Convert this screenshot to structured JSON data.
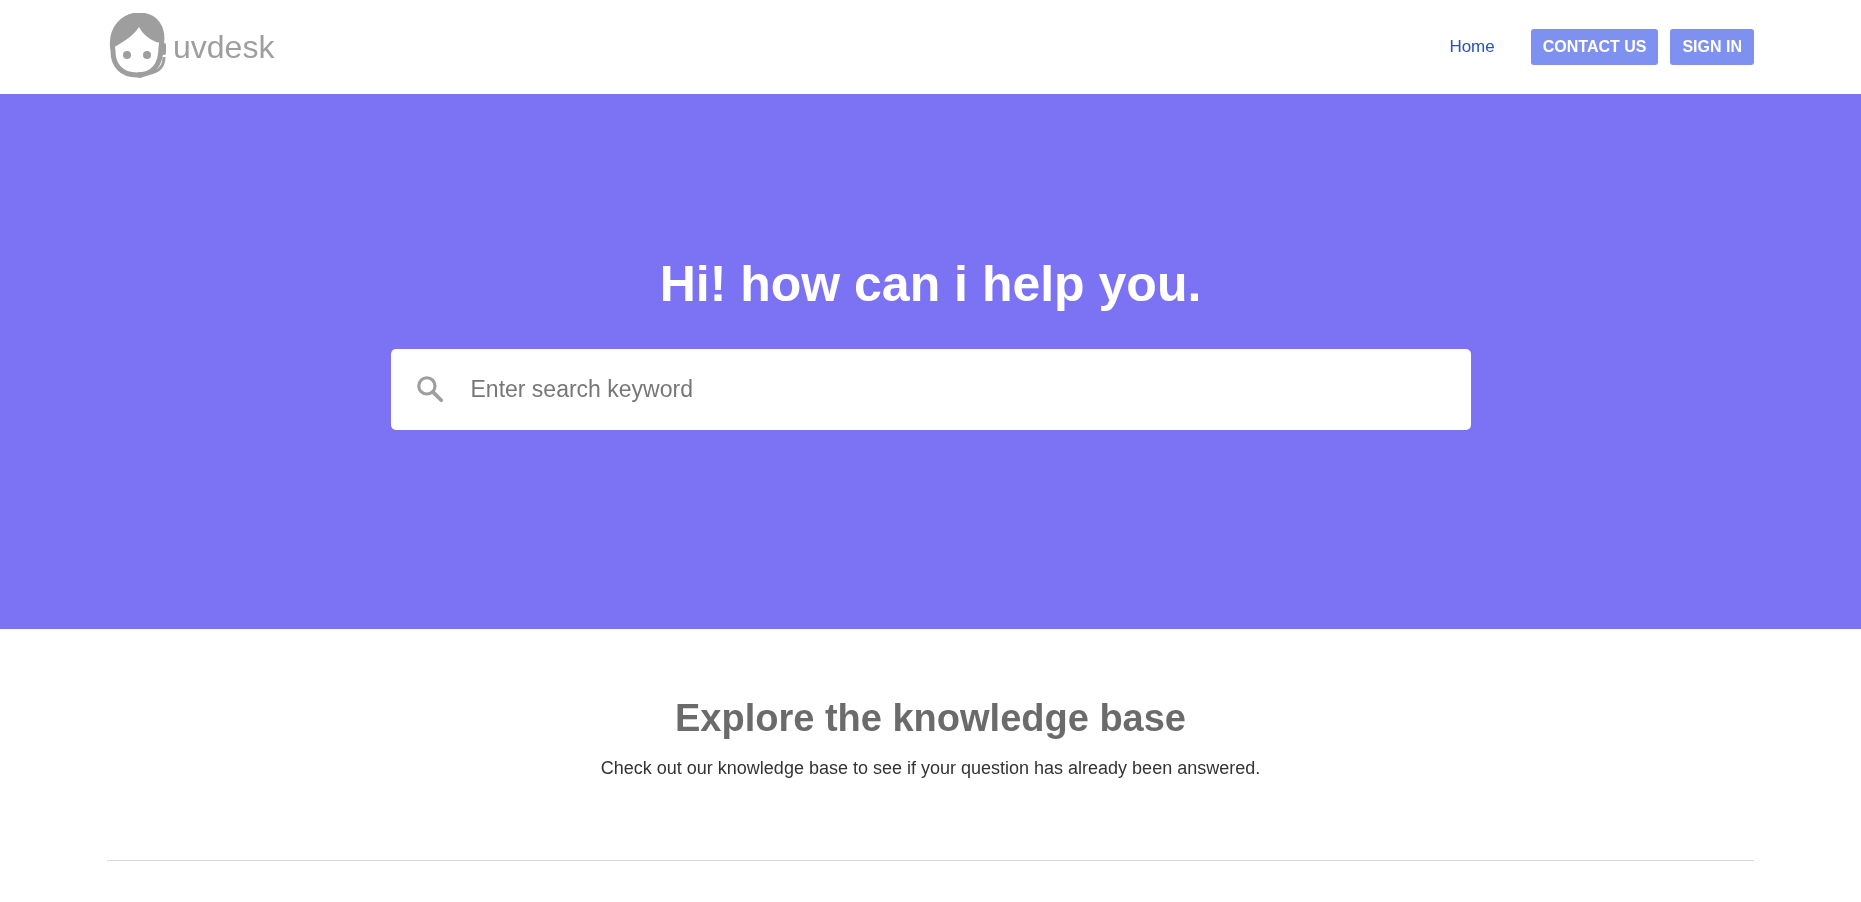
{
  "header": {
    "logo_text": "uvdesk",
    "nav": [
      {
        "kind": "link",
        "label": "Home"
      },
      {
        "kind": "button",
        "label": "CONTACT US"
      },
      {
        "kind": "button",
        "label": "SIGN IN"
      }
    ]
  },
  "hero": {
    "title": "Hi! how can i help you.",
    "search": {
      "placeholder": "Enter search keyword"
    }
  },
  "knowledge_base": {
    "title": "Explore the knowledge base",
    "subtitle": "Check out our knowledge base to see if your question has already been answered."
  }
}
